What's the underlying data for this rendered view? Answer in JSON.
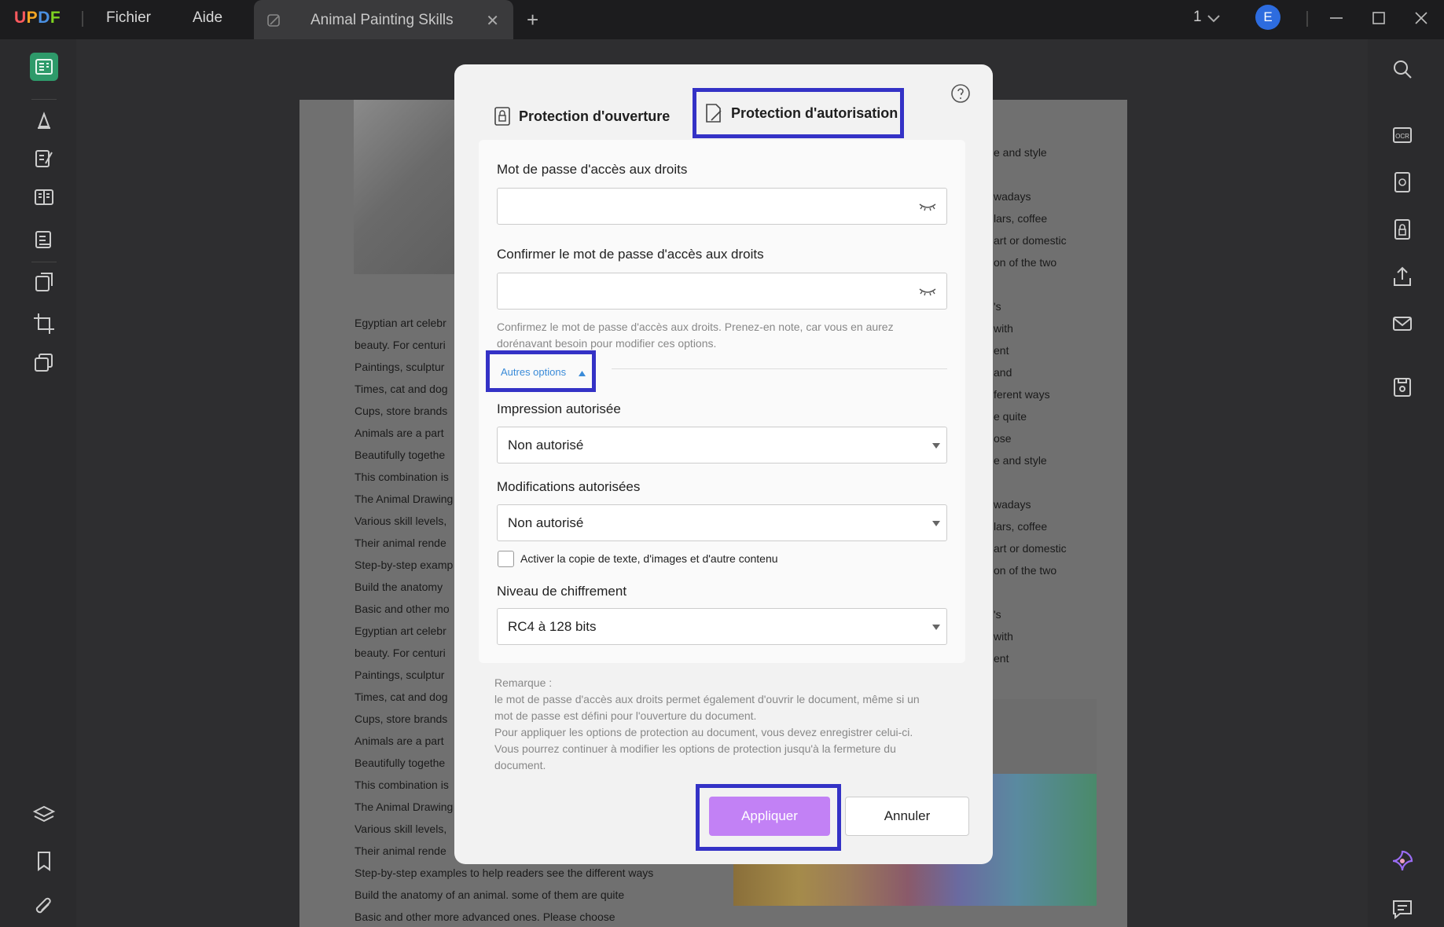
{
  "titlebar": {
    "logo": "UPDF",
    "menu": [
      "Fichier",
      "Aide"
    ],
    "tab_title": "Animal Painting Skills",
    "page_counter": "1",
    "avatar_letter": "E"
  },
  "document": {
    "left_lines": [
      "Egyptian art celebr",
      "beauty. For centuri",
      "Paintings, sculptur",
      "Times, cat and dog",
      "Cups, store brands",
      "Animals are a part",
      "Beautifully togethe",
      "This combination is",
      "The Animal Drawing",
      "Various skill levels,",
      "Their animal rende",
      "Step-by-step examp",
      "Build the anatomy",
      "Basic and other mo",
      "Egyptian art celebr",
      "beauty. For centuri",
      "Paintings, sculptur",
      "Times, cat and dog",
      "Cups, store brands",
      "Animals are a part",
      "Beautifully togethe",
      "This combination is",
      "The Animal Drawing",
      "Various skill levels,",
      "Their animal rende",
      "Step-by-step examples to help readers see the different ways",
      "Build the anatomy of an animal. some of them are quite",
      "Basic and other more advanced ones. Please choose"
    ],
    "right_lines": [
      "e and style",
      "",
      "wadays",
      "lars, coffee",
      "art or domestic",
      "on of the two",
      "",
      "'s",
      "with",
      "ent",
      "and",
      "ferent ways",
      "e quite",
      "ose",
      "e and style",
      "",
      "wadays",
      "lars, coffee",
      "art or domestic",
      "on of the two",
      "",
      "'s",
      "with",
      "ent"
    ]
  },
  "dialog": {
    "tab_open_label": "Protection d'ouverture",
    "tab_perm_label": "Protection d'autorisation",
    "perm_password_label": "Mot de passe d'accès aux droits",
    "perm_password_value": "",
    "confirm_password_label": "Confirmer le mot de passe d'accès aux droits",
    "confirm_password_value": "",
    "confirm_hint": "Confirmez le mot de passe d'accès aux droits. Prenez-en note, car vous en aurez dorénavant besoin pour modifier ces options.",
    "more_options_label": "Autres options",
    "print_label": "Impression autorisée",
    "print_value": "Non autorisé",
    "edit_label": "Modifications autorisées",
    "edit_value": "Non autorisé",
    "copy_checkbox_label": "Activer la copie de texte, d'images et d'autre contenu",
    "copy_checked": false,
    "encryption_label": "Niveau de chiffrement",
    "encryption_value": "RC4 à 128 bits",
    "note_title": "Remarque :",
    "note_lines": [
      "le mot de passe d'accès aux droits permet également d'ouvrir le document, même si un",
      "mot de passe est défini pour l'ouverture du document.",
      "Pour appliquer les options de protection au document, vous devez enregistrer celui-ci.",
      "Vous pourrez continuer à modifier les options de protection jusqu'à la fermeture du",
      "document."
    ],
    "apply_label": "Appliquer",
    "cancel_label": "Annuler"
  },
  "colors": {
    "accent_highlight": "#3432c6",
    "apply_button": "#c281f5",
    "link_blue": "#3a8bd8",
    "sidebar_active": "#2e9a6a"
  }
}
